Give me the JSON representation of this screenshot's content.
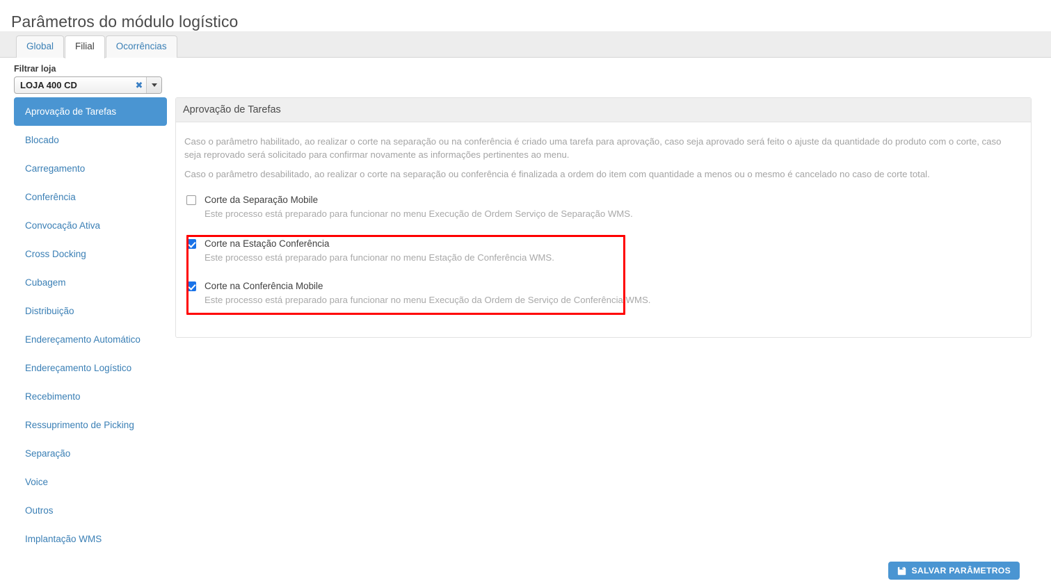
{
  "page": {
    "title": "Parâmetros do módulo logístico"
  },
  "tabs": [
    {
      "label": "Global",
      "active": false
    },
    {
      "label": "Filial",
      "active": true
    },
    {
      "label": "Ocorrências",
      "active": false
    }
  ],
  "store_filter": {
    "label": "Filtrar loja",
    "value": "LOJA 400 CD",
    "clear_icon": "✖",
    "dropdown_icon": "chevron-down-icon"
  },
  "sidebar": {
    "items": [
      {
        "label": "Aprovação de Tarefas",
        "active": true
      },
      {
        "label": "Blocado",
        "active": false
      },
      {
        "label": "Carregamento",
        "active": false
      },
      {
        "label": "Conferência",
        "active": false
      },
      {
        "label": "Convocação Ativa",
        "active": false
      },
      {
        "label": "Cross Docking",
        "active": false
      },
      {
        "label": "Cubagem",
        "active": false
      },
      {
        "label": "Distribuição",
        "active": false
      },
      {
        "label": "Endereçamento Automático",
        "active": false
      },
      {
        "label": "Endereçamento Logístico",
        "active": false
      },
      {
        "label": "Recebimento",
        "active": false
      },
      {
        "label": "Ressuprimento de Picking",
        "active": false
      },
      {
        "label": "Separação",
        "active": false
      },
      {
        "label": "Voice",
        "active": false
      },
      {
        "label": "Outros",
        "active": false
      },
      {
        "label": "Implantação WMS",
        "active": false
      }
    ]
  },
  "panel": {
    "title": "Aprovação de Tarefas",
    "descriptions": [
      "Caso o parâmetro habilitado, ao realizar o corte na separação ou na conferência é criado uma tarefa para aprovação, caso seja aprovado será feito o ajuste da quantidade do produto com o corte, caso seja reprovado será solicitado para confirmar novamente as informações pertinentes ao menu.",
      "Caso o parâmetro desabilitado, ao realizar o corte na separação ou conferência é finalizada a ordem do item com quantidade a menos ou o mesmo é cancelado no caso de corte total."
    ],
    "options": [
      {
        "label": "Corte da Separação Mobile",
        "hint": "Este processo está preparado para funcionar no menu Execução de Ordem Serviço de Separação WMS.",
        "checked": false
      },
      {
        "label": "Corte na Estação Conferência",
        "hint": "Este processo está preparado para funcionar no menu Estação de Conferência WMS.",
        "checked": true
      },
      {
        "label": "Corte na Conferência Mobile",
        "hint": "Este processo está preparado para funcionar no menu Execução da Ordem de Serviço de Conferência WMS.",
        "checked": true
      }
    ]
  },
  "footer": {
    "save_label": "SALVAR PARÂMETROS",
    "save_icon": "save-floppy-icon"
  },
  "colors": {
    "accent_blue": "#4a95d2",
    "link_blue": "#3a7fb5",
    "checkbox_blue": "#1a73e8",
    "annotation_red": "#ff0000",
    "panel_header_gray": "#efefef",
    "tabbar_gray": "#ededed",
    "muted_text": "#a9a9a9"
  }
}
